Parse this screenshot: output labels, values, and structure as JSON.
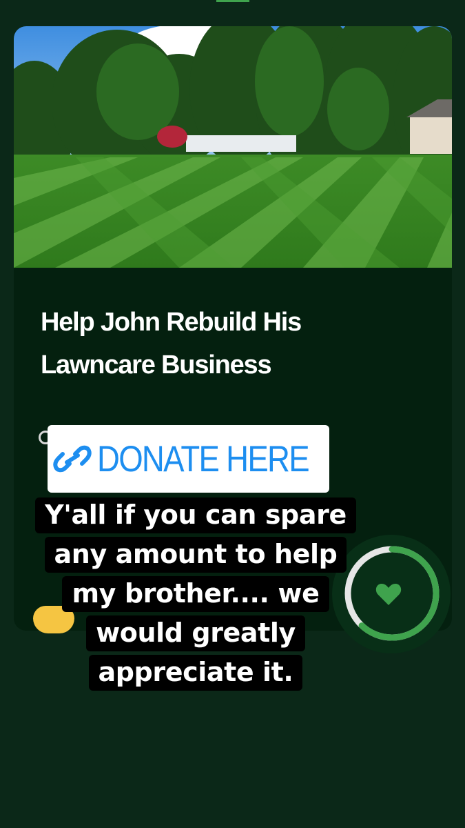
{
  "campaign": {
    "title": "Help John Rebuild His Lawncare Business",
    "hero_image": "striped-lawn-photo",
    "progress_fraction": 0.62
  },
  "sticker": {
    "icon": "link-icon",
    "label": "DONATE HERE"
  },
  "caption": {
    "lines": [
      "Y'all if you can spare",
      "any amount to help",
      "my brother.... we",
      "would greatly",
      "appreciate it."
    ]
  },
  "colors": {
    "background": "#0b2818",
    "card": "#04200f",
    "accent_green": "#3fa34d",
    "link_blue": "#1d8ef0",
    "caption_bg": "#000000"
  }
}
